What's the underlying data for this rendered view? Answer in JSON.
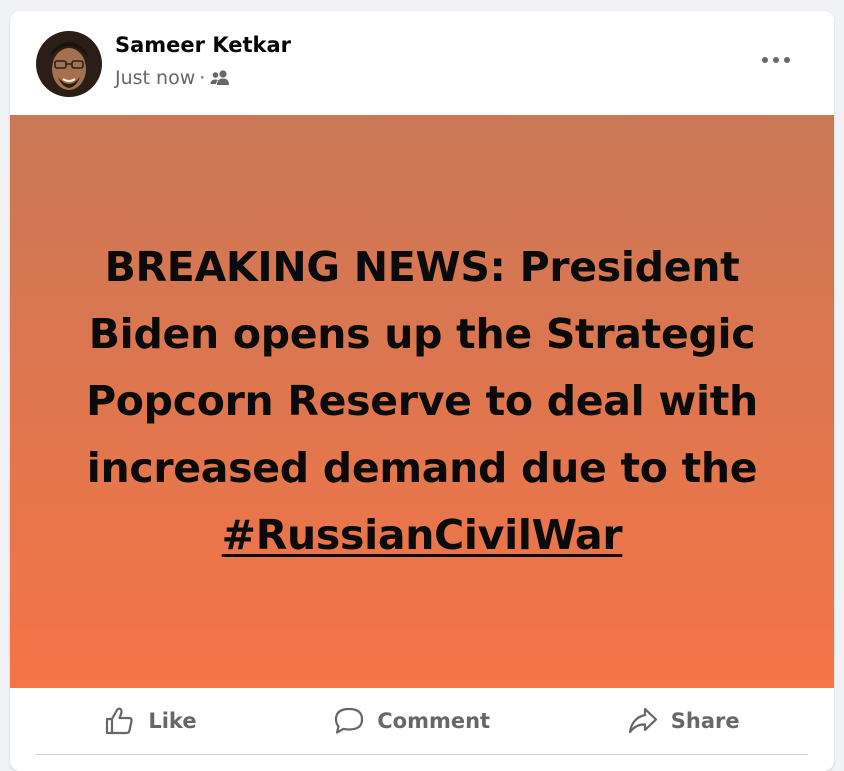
{
  "post": {
    "author": "Sameer Ketkar",
    "timestamp": "Just now",
    "separator": "·",
    "audience_icon": "friends-icon",
    "more_icon": "more-options-icon",
    "text_main": "BREAKING NEWS: President Biden opens up the Strategic Popcorn Reserve to deal with increased demand due to the",
    "hashtag": "#RussianCivilWar",
    "background_colors": [
      "#c97856",
      "#f67447"
    ]
  },
  "actions": {
    "like": "Like",
    "comment": "Comment",
    "share": "Share"
  }
}
